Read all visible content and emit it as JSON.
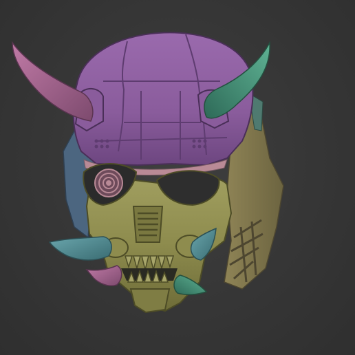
{
  "scene": {
    "subject": "oni-mask-icon",
    "colors": {
      "background": "#393939",
      "helmet_purple": "#8a5c9c",
      "helmet_purple_dark": "#5e3c70",
      "faceplate_olive": "#8e8c4e",
      "faceplate_olive_dark": "#5b5a2e",
      "side_frame_tan": "#8a7f52",
      "teal_panel": "#4f7a70",
      "blue_panel": "#4c6680",
      "horn_pink": "#9a5f86",
      "horn_teal": "#3f8570",
      "fangs_blue_teal": "#4a8088",
      "inner_pink": "#b98a96"
    }
  }
}
